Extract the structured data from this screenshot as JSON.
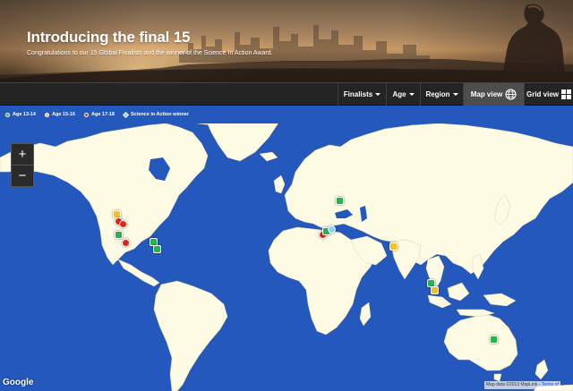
{
  "hero": {
    "title": "Introducing the final 15",
    "subtitle": "Congratulations to our 15 Global Finalists and the winner of the Science In Action Award."
  },
  "toolbar": {
    "finalists_label": "Finalists",
    "age_label": "Age",
    "region_label": "Region",
    "map_view_label": "Map view",
    "grid_view_label": "Grid view"
  },
  "legend": {
    "items": [
      {
        "label": "Age 13-14",
        "color": "#2bb24c"
      },
      {
        "label": "Age 15-16",
        "color": "#f2c12e"
      },
      {
        "label": "Age 17-18",
        "color": "#e2231a"
      },
      {
        "label": "Science in Action winner",
        "color": "#8fd0ff"
      }
    ]
  },
  "map": {
    "zoom_in": "+",
    "zoom_out": "−",
    "attribution": "Map data ©2013 MapLink - ",
    "terms": "Terms of",
    "google": "Google",
    "colors": {
      "water": "#2558bd",
      "land": "#fdfbe3"
    }
  },
  "markers": [
    {
      "name": "marker-canada",
      "color": "#f2c12e"
    },
    {
      "name": "marker-oregon-1",
      "color": "#e2231a"
    },
    {
      "name": "marker-oregon-2",
      "color": "#e2231a"
    },
    {
      "name": "marker-california-1",
      "color": "#2bb24c"
    },
    {
      "name": "marker-california-2",
      "color": "#e2231a"
    },
    {
      "name": "marker-us-east-1",
      "color": "#2bb24c"
    },
    {
      "name": "marker-us-east-2",
      "color": "#2bb24c"
    },
    {
      "name": "marker-russia",
      "color": "#2bb24c"
    },
    {
      "name": "marker-greece",
      "color": "#e2231a"
    },
    {
      "name": "marker-turkey-1",
      "color": "#2bb24c"
    },
    {
      "name": "marker-turkey-2",
      "color": "#8fd0ff"
    },
    {
      "name": "marker-india",
      "color": "#f2c12e"
    },
    {
      "name": "marker-singapore-1",
      "color": "#2bb24c"
    },
    {
      "name": "marker-singapore-2",
      "color": "#f2c12e"
    },
    {
      "name": "marker-australia",
      "color": "#2bb24c"
    }
  ]
}
